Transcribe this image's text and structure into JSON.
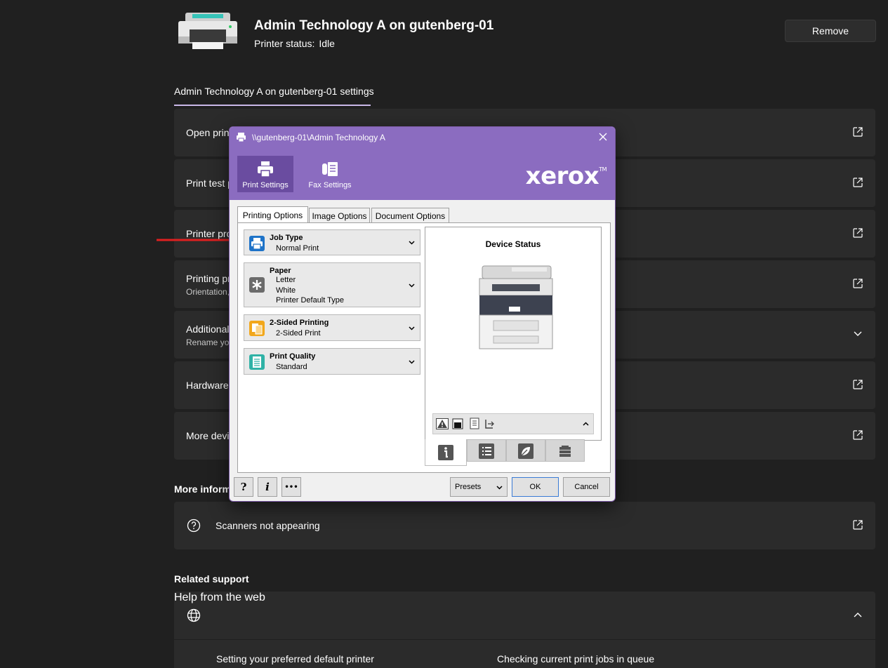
{
  "header": {
    "printer_name": "Admin Technology A on gutenberg-01",
    "status_label": "Printer status:",
    "status_value": "Idle",
    "remove_label": "Remove"
  },
  "settings_tab": "Admin Technology A on gutenberg-01 settings",
  "cards": [
    {
      "title": "Open print queue"
    },
    {
      "title": "Print test page"
    },
    {
      "title": "Printer properties"
    },
    {
      "title": "Printing preferences",
      "subtitle": "Orientation, page order, pages per sheet, borders, paper source"
    },
    {
      "title": "Additional printer settings",
      "subtitle": "Rename your printer"
    },
    {
      "title": "Hardware properties"
    },
    {
      "title": "More devices and printers settings"
    }
  ],
  "more_info": {
    "heading": "More information",
    "item": "Scanners not appearing"
  },
  "related": {
    "heading": "Related support",
    "help_title": "Help from the web",
    "links": [
      "Setting your preferred default printer",
      "Checking current print jobs in queue"
    ]
  },
  "dialog": {
    "title": "\\\\gutenberg-01\\Admin Technology A",
    "print_settings": "Print Settings",
    "fax_settings": "Fax Settings",
    "brand": "xerox",
    "brand_tm": "TM",
    "tabs": [
      "Printing Options",
      "Image Options",
      "Document Options"
    ],
    "options": {
      "job_type": {
        "label": "Job Type",
        "values": [
          "Normal Print"
        ]
      },
      "paper": {
        "label": "Paper",
        "values": [
          "Letter",
          "White",
          "Printer Default Type"
        ]
      },
      "two_sided": {
        "label": "2-Sided Printing",
        "values": [
          "2-Sided Print"
        ]
      },
      "quality": {
        "label": "Print Quality",
        "values": [
          "Standard"
        ]
      }
    },
    "device_status": "Device Status",
    "footer": {
      "help": "?",
      "info": "i",
      "more": "•••",
      "presets": "Presets",
      "ok": "OK",
      "cancel": "Cancel"
    }
  },
  "colors": {
    "page_bg": "#202020",
    "card_bg": "#2b2b2b",
    "dialog_purple": "#8b6cc0",
    "accent_line": "#c9b8e8",
    "arrow": "#e02020"
  }
}
